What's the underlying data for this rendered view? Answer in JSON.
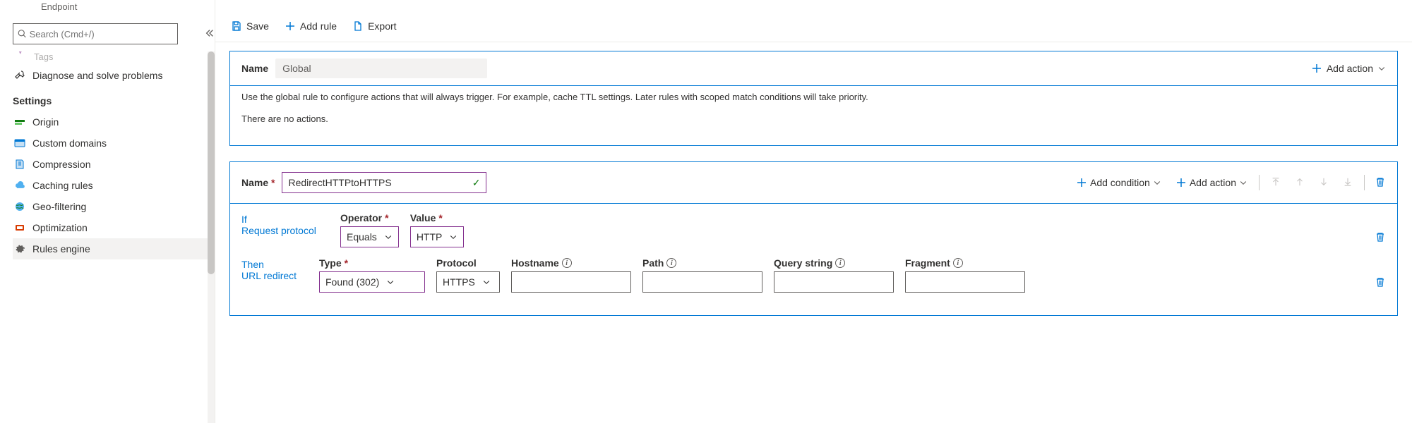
{
  "header": {
    "subtitle": "Endpoint"
  },
  "sidebar": {
    "search_placeholder": "Search (Cmd+/)",
    "partial_top": "Tags",
    "diagnose": {
      "label": "Diagnose and solve problems"
    },
    "settings_heading": "Settings",
    "items": [
      {
        "label": "Origin",
        "icon": "origin-icon",
        "color": "#107c10"
      },
      {
        "label": "Custom domains",
        "icon": "domain-icon",
        "color": "#0078d4"
      },
      {
        "label": "Compression",
        "icon": "compression-icon",
        "color": "#0078d4"
      },
      {
        "label": "Caching rules",
        "icon": "cloud-icon",
        "color": "#0078d4"
      },
      {
        "label": "Geo-filtering",
        "icon": "globe-icon",
        "color": "#ca5010"
      },
      {
        "label": "Optimization",
        "icon": "optimization-icon",
        "color": "#d83b01"
      },
      {
        "label": "Rules engine",
        "icon": "gear-icon",
        "color": "#605e5c"
      }
    ],
    "active_index": 6
  },
  "toolbar": {
    "save_label": "Save",
    "add_rule_label": "Add rule",
    "export_label": "Export"
  },
  "global_rule": {
    "name_label": "Name",
    "name_value": "Global",
    "description": "Use the global rule to configure actions that will always trigger. For example, cache TTL settings. Later rules with scoped match conditions will take priority.",
    "empty_text": "There are no actions.",
    "add_action_label": "Add action"
  },
  "rule": {
    "name_label": "Name",
    "name_value": "RedirectHTTPtoHTTPS",
    "add_condition_label": "Add condition",
    "add_action_label": "Add action",
    "condition": {
      "keyword": "If",
      "subject": "Request protocol",
      "operator_label": "Operator",
      "operator_value": "Equals",
      "value_label": "Value",
      "value_value": "HTTP"
    },
    "action": {
      "keyword": "Then",
      "subject": "URL redirect",
      "type_label": "Type",
      "type_value": "Found (302)",
      "protocol_label": "Protocol",
      "protocol_value": "HTTPS",
      "hostname_label": "Hostname",
      "path_label": "Path",
      "querystring_label": "Query string",
      "fragment_label": "Fragment"
    }
  }
}
